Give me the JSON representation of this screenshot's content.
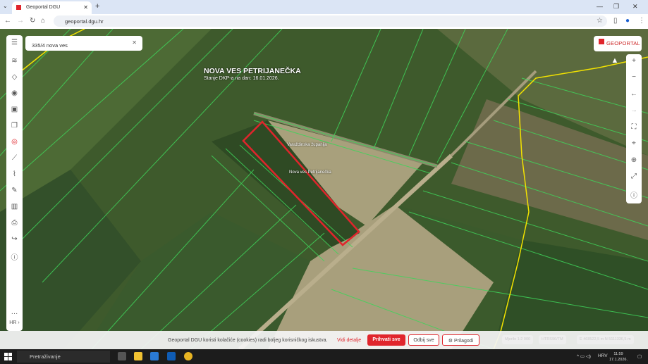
{
  "browser": {
    "tab_title": "Geoportal DGU",
    "url": "geoportal.dgu.hr"
  },
  "search": {
    "value": "335/4 nova ves"
  },
  "map": {
    "title": "NOVA VES PETRIJANEČKA",
    "subtitle": "Stanje DKP-a na dan: 16.01.2026.",
    "labels": [
      "Varaždinska županija",
      "Nova ves Petrijanečka"
    ],
    "highlight_color": "#e0252c",
    "parcel_color": "#3fd45a",
    "boundary_color": "#f2e200"
  },
  "left_toolbar": {
    "icons": [
      "menu-icon",
      "layers-icon",
      "diamond-icon",
      "eye-icon",
      "id-card-icon",
      "copy-icon",
      "location-target-icon",
      "ruler-icon",
      "chart-icon",
      "pen-icon",
      "bar-chart-icon",
      "print-icon",
      "share-icon",
      "help-icon",
      "more-icon"
    ],
    "language": "HR"
  },
  "right_toolbar": {
    "icons": [
      "zoom-in-icon",
      "zoom-out-icon",
      "back-icon",
      "forward-icon",
      "fullscreen-icon",
      "location-pin-icon",
      "globe-icon",
      "measure-icon",
      "info-icon"
    ]
  },
  "logo": "GEOPORTAL",
  "cookie": {
    "text": "Geoportal DGU koristi kolačiće (cookies) radi boljeg korisničkog iskustva.",
    "details": "Vidi detalje",
    "accept": "Prihvati sve",
    "reject": "Odbij sve",
    "customize": "Prilagodi"
  },
  "status": {
    "scale": "Mjerilo 1:2 000",
    "crs": "HTRS96/TM",
    "coords": "E 468522,5 m N 5111336,5 m"
  },
  "taskbar": {
    "search": "Pretraživanje",
    "language": "HRV",
    "time": "11:59",
    "date": "17.1.2026."
  }
}
